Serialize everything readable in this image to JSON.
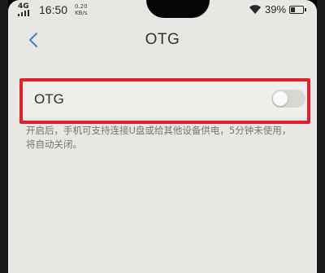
{
  "status_bar": {
    "network": "4G",
    "time": "16:50",
    "speed_value": "0.20",
    "speed_unit": "KB/s",
    "battery_percent": "39%",
    "battery_level": 0.39
  },
  "nav": {
    "back_icon": "chevron-left-icon",
    "title": "OTG"
  },
  "setting": {
    "label": "OTG",
    "toggle_on": false,
    "description": "开启后，手机可支持连接U盘或给其他设备供电，5分钟未使用，将自动关闭。"
  },
  "colors": {
    "accent": "#4a7fd0",
    "highlight": "#e0202a",
    "background": "#e8e7e4"
  }
}
